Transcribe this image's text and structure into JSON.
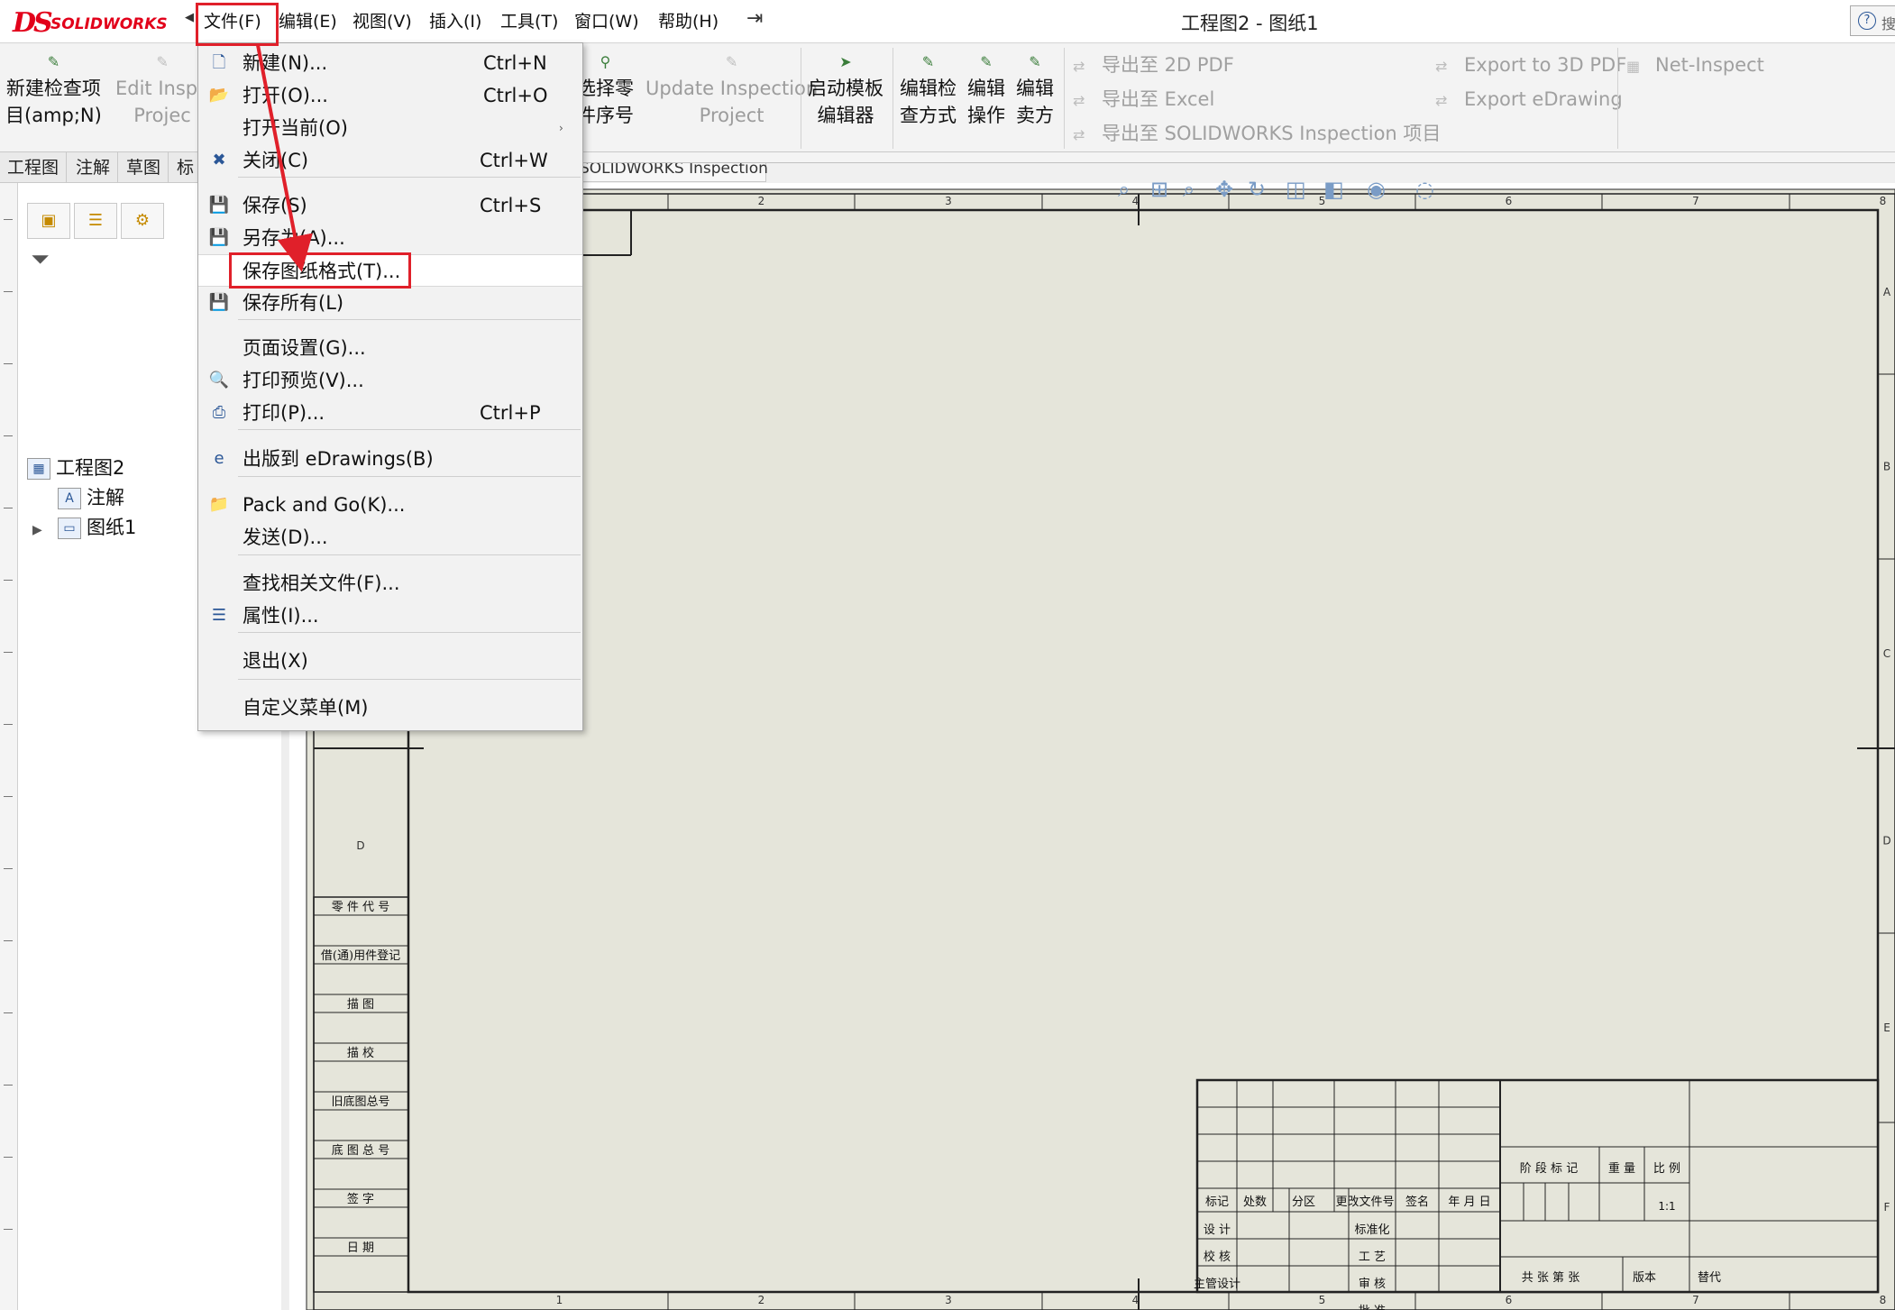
{
  "app": {
    "logo_ds": "DS",
    "logo_text": "SOLIDWORKS",
    "window_title": "工程图2 - 图纸1",
    "help": "?",
    "search_stub": "搜"
  },
  "menubar": [
    {
      "label": "文件(F)"
    },
    {
      "label": "编辑(E)"
    },
    {
      "label": "视图(V)"
    },
    {
      "label": "插入(I)"
    },
    {
      "label": "工具(T)"
    },
    {
      "label": "窗口(W)"
    },
    {
      "label": "帮助(H)"
    }
  ],
  "command_manager": {
    "new_inspection": {
      "line1": "新建检查项",
      "line2": "目(amp;N)"
    },
    "edit_inspection": {
      "line1": "Edit Inspe",
      "line2": "Projec"
    },
    "select_balloon": {
      "line1": "选择零",
      "line2": "件序号"
    },
    "update_inspection": {
      "line1": "Update Inspection",
      "line2": "Project"
    },
    "template_editor": {
      "line1": "启动模板",
      "line2": "编辑器"
    },
    "edit_method": {
      "line1": "编辑检",
      "line2": "查方式"
    },
    "edit_operation": {
      "line1": "编辑",
      "line2": "操作"
    },
    "edit_vendor": {
      "line1": "编辑",
      "line2": "卖方"
    },
    "export_2d_pdf": "导出至 2D PDF",
    "export_excel": "导出至 Excel",
    "export_sw_inspection": "导出至 SOLIDWORKS Inspection 项目",
    "export_3d_pdf": "Export to 3D PDF",
    "export_edrawing": "Export eDrawing",
    "net_inspect": "Net-Inspect"
  },
  "tabs": [
    "工程图",
    "注解",
    "草图",
    "标"
  ],
  "inspection_tab": "SOLIDWORKS Inspection",
  "feature_tree": {
    "root": "工程图2",
    "annotations": "注解",
    "sheet": "图纸1"
  },
  "file_menu": {
    "items": [
      {
        "label": "新建(N)...",
        "shortcut": "Ctrl+N",
        "icon": "new-document-icon"
      },
      {
        "label": "打开(O)...",
        "shortcut": "Ctrl+O",
        "icon": "open-folder-icon"
      },
      {
        "label": "打开当前(O)",
        "shortcut": "",
        "icon": "",
        "submenu": "›"
      },
      {
        "label": "关闭(C)",
        "shortcut": "Ctrl+W",
        "icon": "close-document-icon"
      },
      {
        "label": "保存(S)",
        "shortcut": "Ctrl+S",
        "icon": "save-icon"
      },
      {
        "label": "另存为(A)...",
        "shortcut": "",
        "icon": "save-as-icon"
      },
      {
        "label": "保存图纸格式(T)...",
        "shortcut": "",
        "icon": ""
      },
      {
        "label": "保存所有(L)",
        "shortcut": "",
        "icon": "save-all-icon"
      },
      {
        "label": "页面设置(G)...",
        "shortcut": "",
        "icon": ""
      },
      {
        "label": "打印预览(V)...",
        "shortcut": "",
        "icon": "print-preview-icon"
      },
      {
        "label": "打印(P)...",
        "shortcut": "Ctrl+P",
        "icon": "printer-icon"
      },
      {
        "label": "出版到 eDrawings(B)",
        "shortcut": "",
        "icon": "edrawings-icon"
      },
      {
        "label": "Pack and Go(K)...",
        "shortcut": "",
        "icon": "pack-and-go-icon"
      },
      {
        "label": "发送(D)...",
        "shortcut": "",
        "icon": ""
      },
      {
        "label": "查找相关文件(F)...",
        "shortcut": "",
        "icon": ""
      },
      {
        "label": "属性(I)...",
        "shortcut": "",
        "icon": "properties-icon"
      },
      {
        "label": "退出(X)",
        "shortcut": "",
        "icon": ""
      },
      {
        "label": "自定义菜单(M)",
        "shortcut": "",
        "icon": ""
      }
    ]
  },
  "sheet": {
    "col_labels": [
      "1",
      "2",
      "3",
      "4",
      "5",
      "6",
      "7",
      "8"
    ],
    "row_labels": [
      "A",
      "B",
      "C",
      "D",
      "E",
      "F"
    ],
    "left_zone_label": "D",
    "left_column": [
      "零 件 代 号",
      "借(通)用件登记",
      "描 图",
      "描 校",
      "旧底图总号",
      "底 图 总 号",
      "签 字",
      "日 期"
    ],
    "title_block": {
      "revision_header": [
        "标记",
        "处数",
        "分区",
        "更改文件号",
        "签名",
        "年 月 日"
      ],
      "roles_left": [
        "设 计",
        "校 核",
        "主管设计"
      ],
      "roles_mid": [
        "标准化",
        "工 艺",
        "审 核",
        "批 准"
      ],
      "stage": "阶 段 标 记",
      "weight": "重 量",
      "scale": "比 例",
      "scale_value": "1:1",
      "sheets": "共 张 第 张",
      "version": "版本",
      "replace": "替代"
    }
  },
  "colors": {
    "sheet_bg": "#e5e5da",
    "highlight_red": "#e0202a",
    "brand_red": "#e2001a"
  }
}
